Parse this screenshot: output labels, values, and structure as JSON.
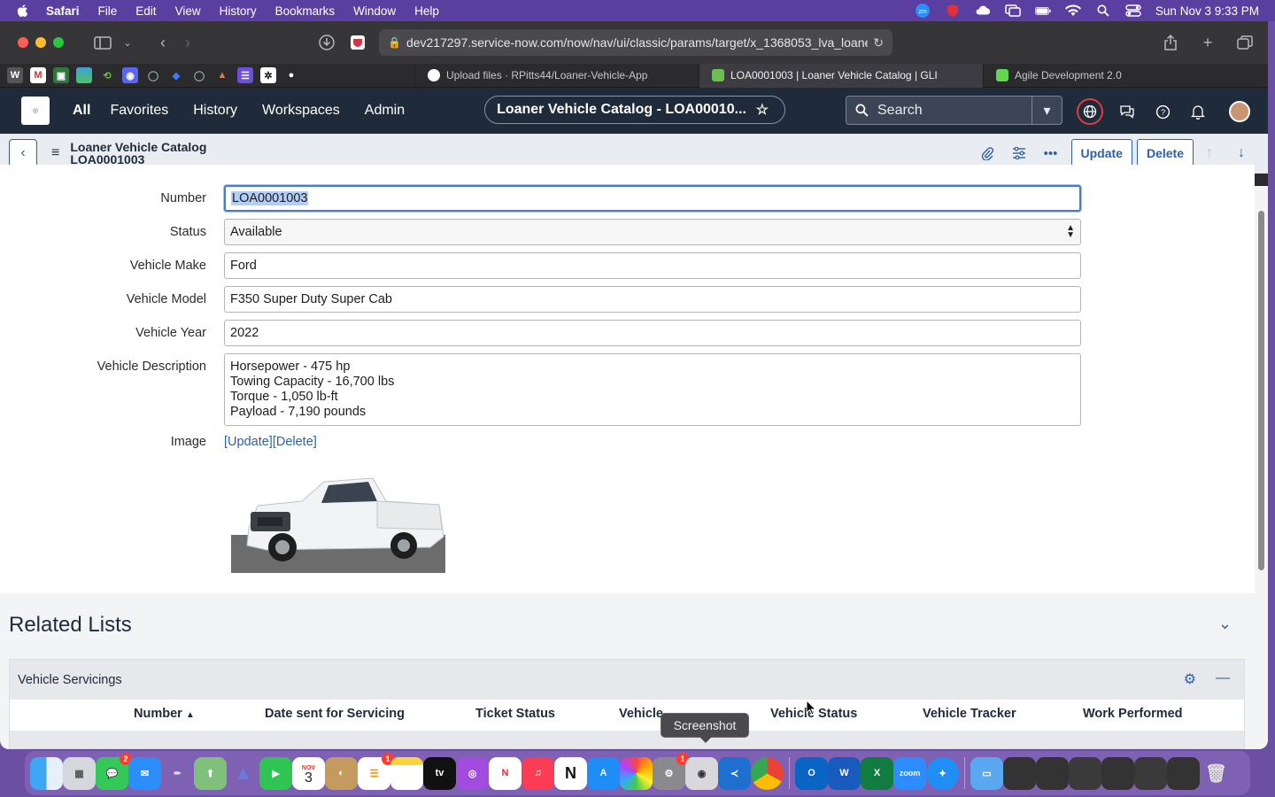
{
  "menubar": {
    "app": "Safari",
    "items": [
      "File",
      "Edit",
      "View",
      "History",
      "Bookmarks",
      "Window",
      "Help"
    ],
    "clock": "Sun Nov 3  9:33 PM"
  },
  "browser": {
    "url": "dev217297.service-now.com/now/nav/ui/classic/params/target/x_1368053_lva_loane",
    "tabs": [
      {
        "label": "Upload files · RPitts44/Loaner-Vehicle-App",
        "active": false,
        "icon_color": "#ffffff"
      },
      {
        "label": "LOA0001003 | Loaner Vehicle Catalog | GLI",
        "active": true,
        "icon_color": "#6bbf4e"
      },
      {
        "label": "Agile Development 2.0",
        "active": false,
        "icon_color": "#62d84e"
      }
    ]
  },
  "sn_header": {
    "nav": [
      "All",
      "Favorites",
      "History",
      "Workspaces",
      "Admin"
    ],
    "context_title": "Loaner Vehicle Catalog - LOA00010...",
    "search_placeholder": "Search"
  },
  "form_header": {
    "title_line1": "Loaner Vehicle Catalog",
    "title_line2": "LOA0001003",
    "update_label": "Update",
    "delete_label": "Delete"
  },
  "form": {
    "number_label": "Number",
    "number_value": "LOA0001003",
    "status_label": "Status",
    "status_value": "Available",
    "make_label": "Vehicle Make",
    "make_value": "Ford",
    "model_label": "Vehicle Model",
    "model_value": "F350 Super Duty Super Cab",
    "year_label": "Vehicle Year",
    "year_value": "2022",
    "description_label": "Vehicle Description",
    "description_lines": [
      "Horsepower - 475 hp",
      "Towing Capacity - 16,700 lbs",
      "Torque - 1,050 lb-ft",
      "Payload - 7,190 pounds"
    ],
    "image_label": "Image",
    "image_update": "[Update]",
    "image_delete": "[Delete]"
  },
  "related": {
    "title": "Related Lists",
    "list_title": "Vehicle Servicings",
    "columns": [
      "Number",
      "Date sent for Servicing",
      "Ticket Status",
      "Vehicle",
      "Vehicle Status",
      "Vehicle Tracker",
      "Work Performed"
    ]
  },
  "tooltip": "Screenshot",
  "dock": {
    "badges": {
      "messages": "2",
      "reminders": "1",
      "settings": "1"
    },
    "calendar_month": "NOV",
    "calendar_day": "3"
  }
}
